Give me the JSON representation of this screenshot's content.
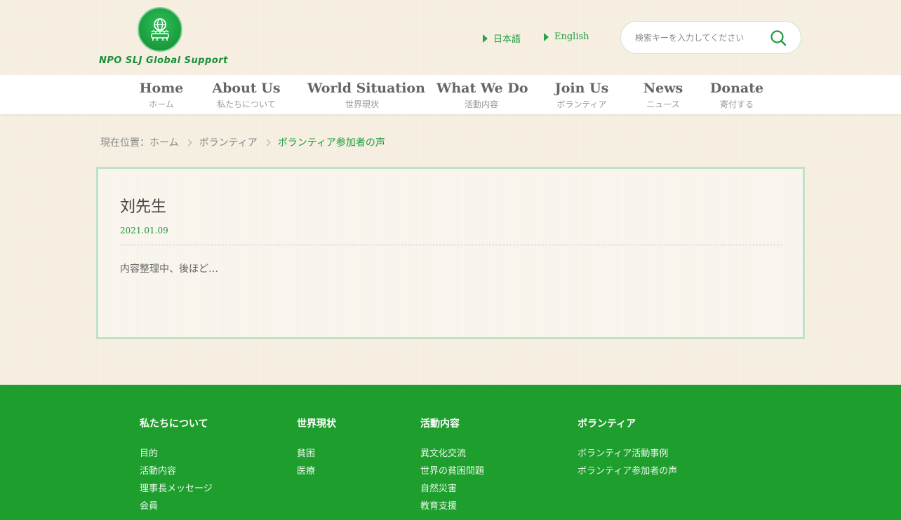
{
  "header": {
    "logo_text": "NPO SLJ Global Support",
    "lang_ja": "日本語",
    "lang_en": "English",
    "search_placeholder": "検索キーを入力してください"
  },
  "nav": [
    {
      "en": "Home",
      "ja": "ホーム"
    },
    {
      "en": "About Us",
      "ja": "私たちについて"
    },
    {
      "en": "World Situation",
      "ja": "世界現状"
    },
    {
      "en": "What We Do",
      "ja": "活動内容"
    },
    {
      "en": "Join Us",
      "ja": "ボランティア"
    },
    {
      "en": "News",
      "ja": "ニュース"
    },
    {
      "en": "Donate",
      "ja": "寄付する"
    }
  ],
  "breadcrumb": {
    "prefix": "現在位置：",
    "home": "ホーム",
    "parent": "ボランティア",
    "current": "ボランティア参加者の声"
  },
  "article": {
    "title": "刘先生",
    "date": "2021.01.09",
    "body": "内容整理中、後ほど…"
  },
  "footer": {
    "columns": [
      {
        "title": "私たちについて",
        "links": [
          "目的",
          "活動内容",
          "理事長メッセージ",
          "会員"
        ]
      },
      {
        "title": "世界現状",
        "links": [
          "貧困",
          "医療"
        ]
      },
      {
        "title": "活動内容",
        "links": [
          "異文化交流",
          "世界の貧困問題",
          "自然災害",
          "教育支援"
        ]
      },
      {
        "title": "ボランティア",
        "links": [
          "ボランティア活動事例",
          "ボランティア参加者の声"
        ]
      }
    ]
  },
  "colors": {
    "brand_green": "#1e9f2d",
    "accent_green": "#1f9a3e",
    "box_border": "#bfe2c7"
  }
}
